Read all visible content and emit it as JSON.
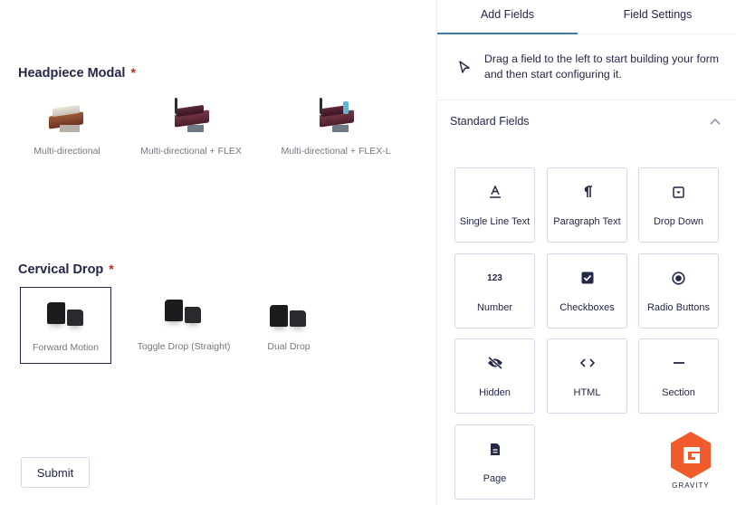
{
  "form": {
    "headpiece": {
      "label": "Headpiece Modal",
      "required_mark": "*",
      "choices": [
        {
          "label": "Multi-directional"
        },
        {
          "label": "Multi-directional + FLEX"
        },
        {
          "label": "Multi-directional + FLEX-L"
        }
      ]
    },
    "cervical": {
      "label": "Cervical Drop",
      "required_mark": "*",
      "choices": [
        {
          "label": "Forward Motion",
          "selected": true
        },
        {
          "label": "Toggle Drop (Straight)"
        },
        {
          "label": "Dual Drop"
        }
      ]
    },
    "submit_label": "Submit"
  },
  "sidebar": {
    "tabs": [
      {
        "label": "Add Fields",
        "active": true
      },
      {
        "label": "Field Settings",
        "active": false
      }
    ],
    "hint": "Drag a field to the left to start building your form and then start configuring it.",
    "section_title": "Standard Fields",
    "fields": [
      {
        "label": "Single Line Text",
        "icon": "single-line-text-icon"
      },
      {
        "label": "Paragraph Text",
        "icon": "paragraph-icon"
      },
      {
        "label": "Drop Down",
        "icon": "dropdown-icon"
      },
      {
        "label": "Number",
        "icon": "number-icon",
        "glyph": "123"
      },
      {
        "label": "Checkboxes",
        "icon": "checkbox-icon"
      },
      {
        "label": "Radio Buttons",
        "icon": "radio-icon"
      },
      {
        "label": "Hidden",
        "icon": "eye-off-icon"
      },
      {
        "label": "HTML",
        "icon": "code-icon"
      },
      {
        "label": "Section",
        "icon": "minus-icon"
      },
      {
        "label": "Page",
        "icon": "document-icon"
      }
    ],
    "logo_text": "GRAVITY"
  },
  "colors": {
    "accent": "#3e7da6",
    "required": "#c02b0a",
    "text": "#242748",
    "border": "#d5d7e9",
    "logo": "#f15a2b"
  }
}
